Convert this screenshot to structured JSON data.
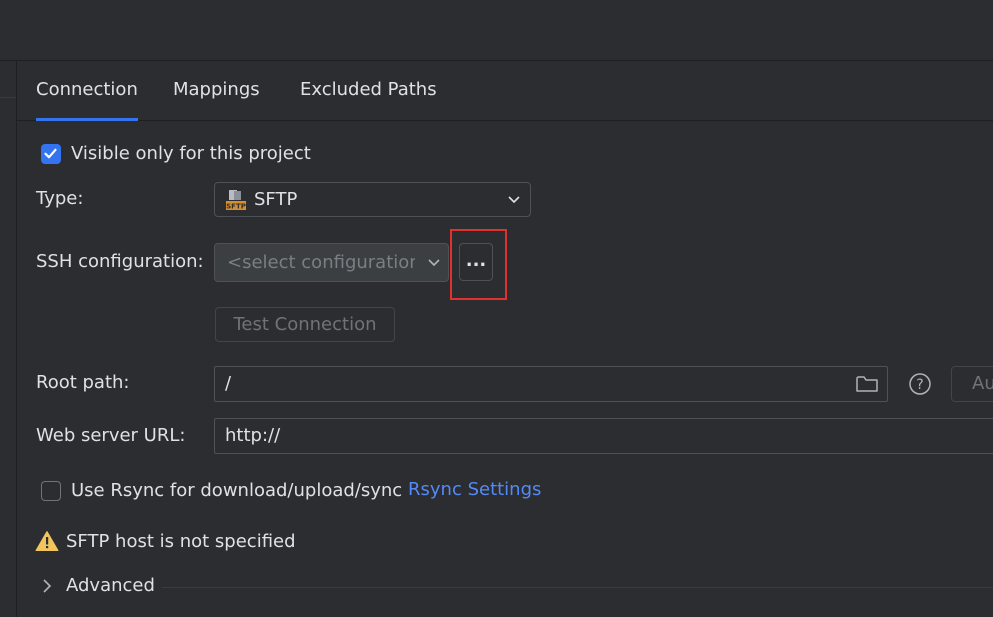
{
  "tabs": [
    {
      "label": "Connection",
      "active": true
    },
    {
      "label": "Mappings",
      "active": false
    },
    {
      "label": "Excluded Paths",
      "active": false
    }
  ],
  "visible_only": {
    "label": "Visible only for this project",
    "checked": true
  },
  "type": {
    "label": "Type:",
    "value": "SFTP",
    "icon": "sftp-icon"
  },
  "ssh": {
    "label": "SSH configuration:",
    "placeholder": "<select configuration>",
    "browse_label": "..."
  },
  "test_connection": {
    "label": "Test Connection",
    "enabled": false
  },
  "root_path": {
    "label": "Root path:",
    "value": "/",
    "autodetect_label": "Au"
  },
  "web_server": {
    "label": "Web server URL:",
    "value": "http://"
  },
  "rsync": {
    "label": "Use Rsync for download/upload/sync",
    "checked": false,
    "settings_link": "Rsync Settings"
  },
  "warning": {
    "text": "SFTP host is not specified",
    "icon": "warning-icon"
  },
  "advanced": {
    "label": "Advanced"
  },
  "colors": {
    "accent": "#3574f0",
    "link": "#548af7",
    "warning": "#f2c55c",
    "highlight": "#e0312f",
    "background": "#2b2d30"
  }
}
